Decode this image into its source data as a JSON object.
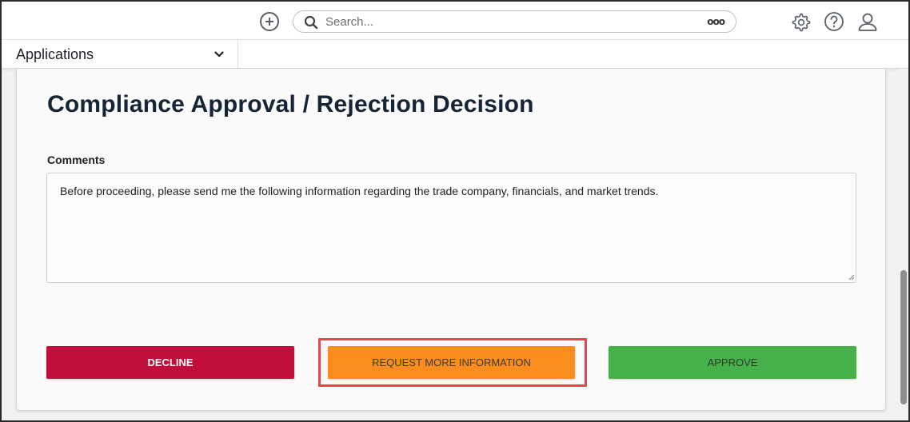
{
  "header": {
    "search": {
      "placeholder": "Search...",
      "more_label": "ooo"
    },
    "icons": [
      "add-circle-icon",
      "search-icon",
      "gear-icon",
      "help-icon",
      "user-icon"
    ]
  },
  "appbar": {
    "application_label": "Applications"
  },
  "form": {
    "title": "Compliance Approval / Rejection Decision",
    "comments_label": "Comments",
    "comments_value": "Before proceeding, please send me the following information regarding the trade company, financials, and market trends."
  },
  "actions": {
    "decline_label": "DECLINE",
    "request_label": "REQUEST MORE INFORMATION",
    "approve_label": "APPROVE"
  },
  "colors": {
    "decline": "#c20e3b",
    "request": "#fb8d1c",
    "approve": "#46b04a",
    "highlight": "#e2474b",
    "title": "#162435"
  }
}
